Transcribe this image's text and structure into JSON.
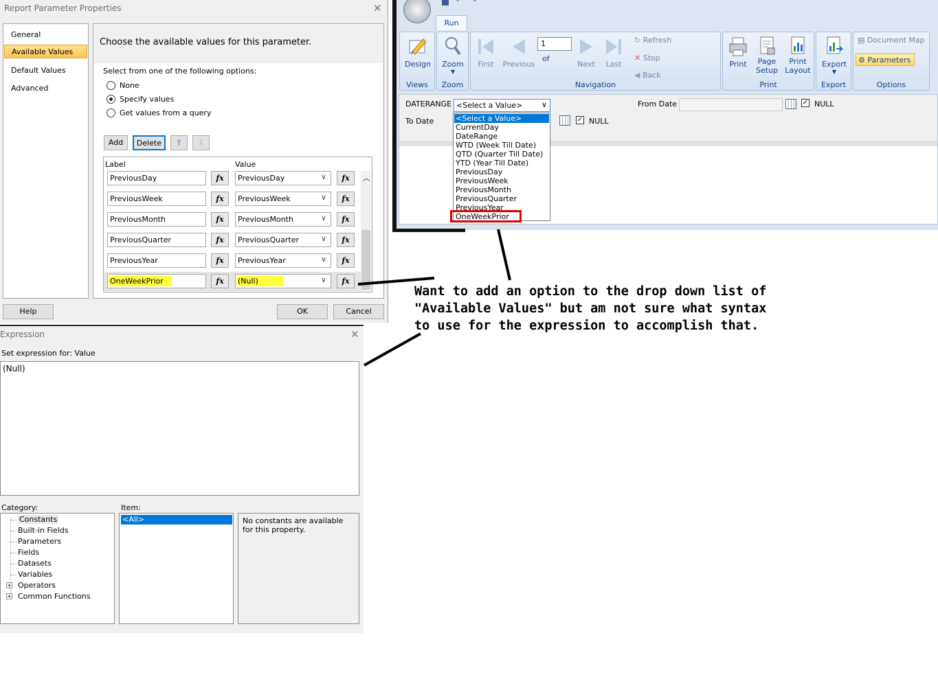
{
  "param_dialog": {
    "title": "Report Parameter Properties",
    "nav": [
      "General",
      "Available Values",
      "Default Values",
      "Advanced"
    ],
    "heading": "Choose the available values for this parameter.",
    "options_label": "Select from one of the following options:",
    "radio_options": [
      "None",
      "Specify values",
      "Get values from a query"
    ],
    "selected_option": "Specify values",
    "buttons": {
      "add": "Add",
      "delete": "Delete",
      "help": "Help",
      "ok": "OK",
      "cancel": "Cancel"
    },
    "grid_headers": {
      "label": "Label",
      "value": "Value"
    },
    "rows": [
      {
        "label": "PreviousDay",
        "value": "PreviousDay"
      },
      {
        "label": "PreviousWeek",
        "value": "PreviousWeek"
      },
      {
        "label": "PreviousMonth",
        "value": "PreviousMonth"
      },
      {
        "label": "PreviousQuarter",
        "value": "PreviousQuarter"
      },
      {
        "label": "PreviousYear",
        "value": "PreviousYear"
      },
      {
        "label": "OneWeekPrior",
        "value": "(Null)"
      }
    ],
    "fx": "fx"
  },
  "expression_dialog": {
    "title": "Expression",
    "set_for": "Set expression for: Value",
    "expression": "(Null)",
    "category_label": "Category:",
    "item_label": "Item:",
    "categories": [
      "Constants",
      "Built-in Fields",
      "Parameters",
      "Fields",
      "Datasets",
      "Variables",
      "Operators",
      "Common Functions"
    ],
    "items": [
      "<All>"
    ],
    "description": "No constants are available for this property."
  },
  "viewer": {
    "tab": "Run",
    "views_group": "Views",
    "design": "Design",
    "zoom_group": "Zoom",
    "zoom": "Zoom",
    "navigation_group": "Navigation",
    "first": "First",
    "previous": "Previous",
    "page": "1",
    "of": "of",
    "next": "Next",
    "last": "Last",
    "refresh": "Refresh",
    "stop": "Stop",
    "back": "Back",
    "print_group": "Print",
    "print": "Print",
    "page_setup_1": "Page",
    "page_setup_2": "Setup",
    "print_layout_1": "Print",
    "print_layout_2": "Layout",
    "export_group": "Export",
    "export": "Export",
    "options_group": "Options",
    "document_map": "Document Map",
    "parameters": "Parameters",
    "daterange_label": "DATERANGE",
    "daterange_value": "<Select a Value>",
    "from_date_label": "From Date",
    "to_date_label": "To Date",
    "null_label": "NULL",
    "dropdown_items": [
      "<Select a Value>",
      "CurrentDay",
      "DateRange",
      "WTD (Week Till Date)",
      "QTD (Quarter Till Date)",
      "YTD (Year Till Date)",
      "PreviousDay",
      "PreviousWeek",
      "PreviousMonth",
      "PreviousQuarter",
      "PreviousYear",
      "OneWeekPrior"
    ]
  },
  "annotation": {
    "line1": "Want to add an option to the drop down list of",
    "line2": "\"Available Values\" but am not sure what syntax",
    "line3": "to use for the expression to accomplish that."
  },
  "colors": {
    "highlight": "#ffff3a",
    "red_box": "#e00000",
    "selection": "#0078d7",
    "ribbon_text": "#15428b"
  }
}
